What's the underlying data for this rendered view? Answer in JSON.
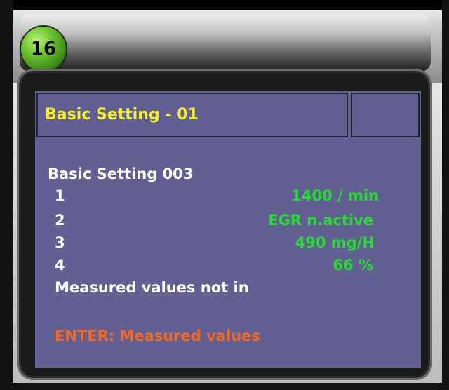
{
  "badge": {
    "number": "16"
  },
  "screen": {
    "title": "Basic Setting - 01",
    "group_label": "Basic Setting 003",
    "rows": [
      {
        "index": "1",
        "value": "1400 / min"
      },
      {
        "index": "2",
        "value": "EGR n.active"
      },
      {
        "index": "3",
        "value": "490 mg/H"
      },
      {
        "index": "4",
        "value": "66 %"
      }
    ],
    "status_message": "Measured values not in",
    "action_hint": "ENTER: Measured values"
  },
  "colors": {
    "screen_bg": "#625f93",
    "title_text": "#f4f02a",
    "value_text": "#25dd2e",
    "hint_text": "#f26a21",
    "badge_green": "#6cc42d"
  }
}
